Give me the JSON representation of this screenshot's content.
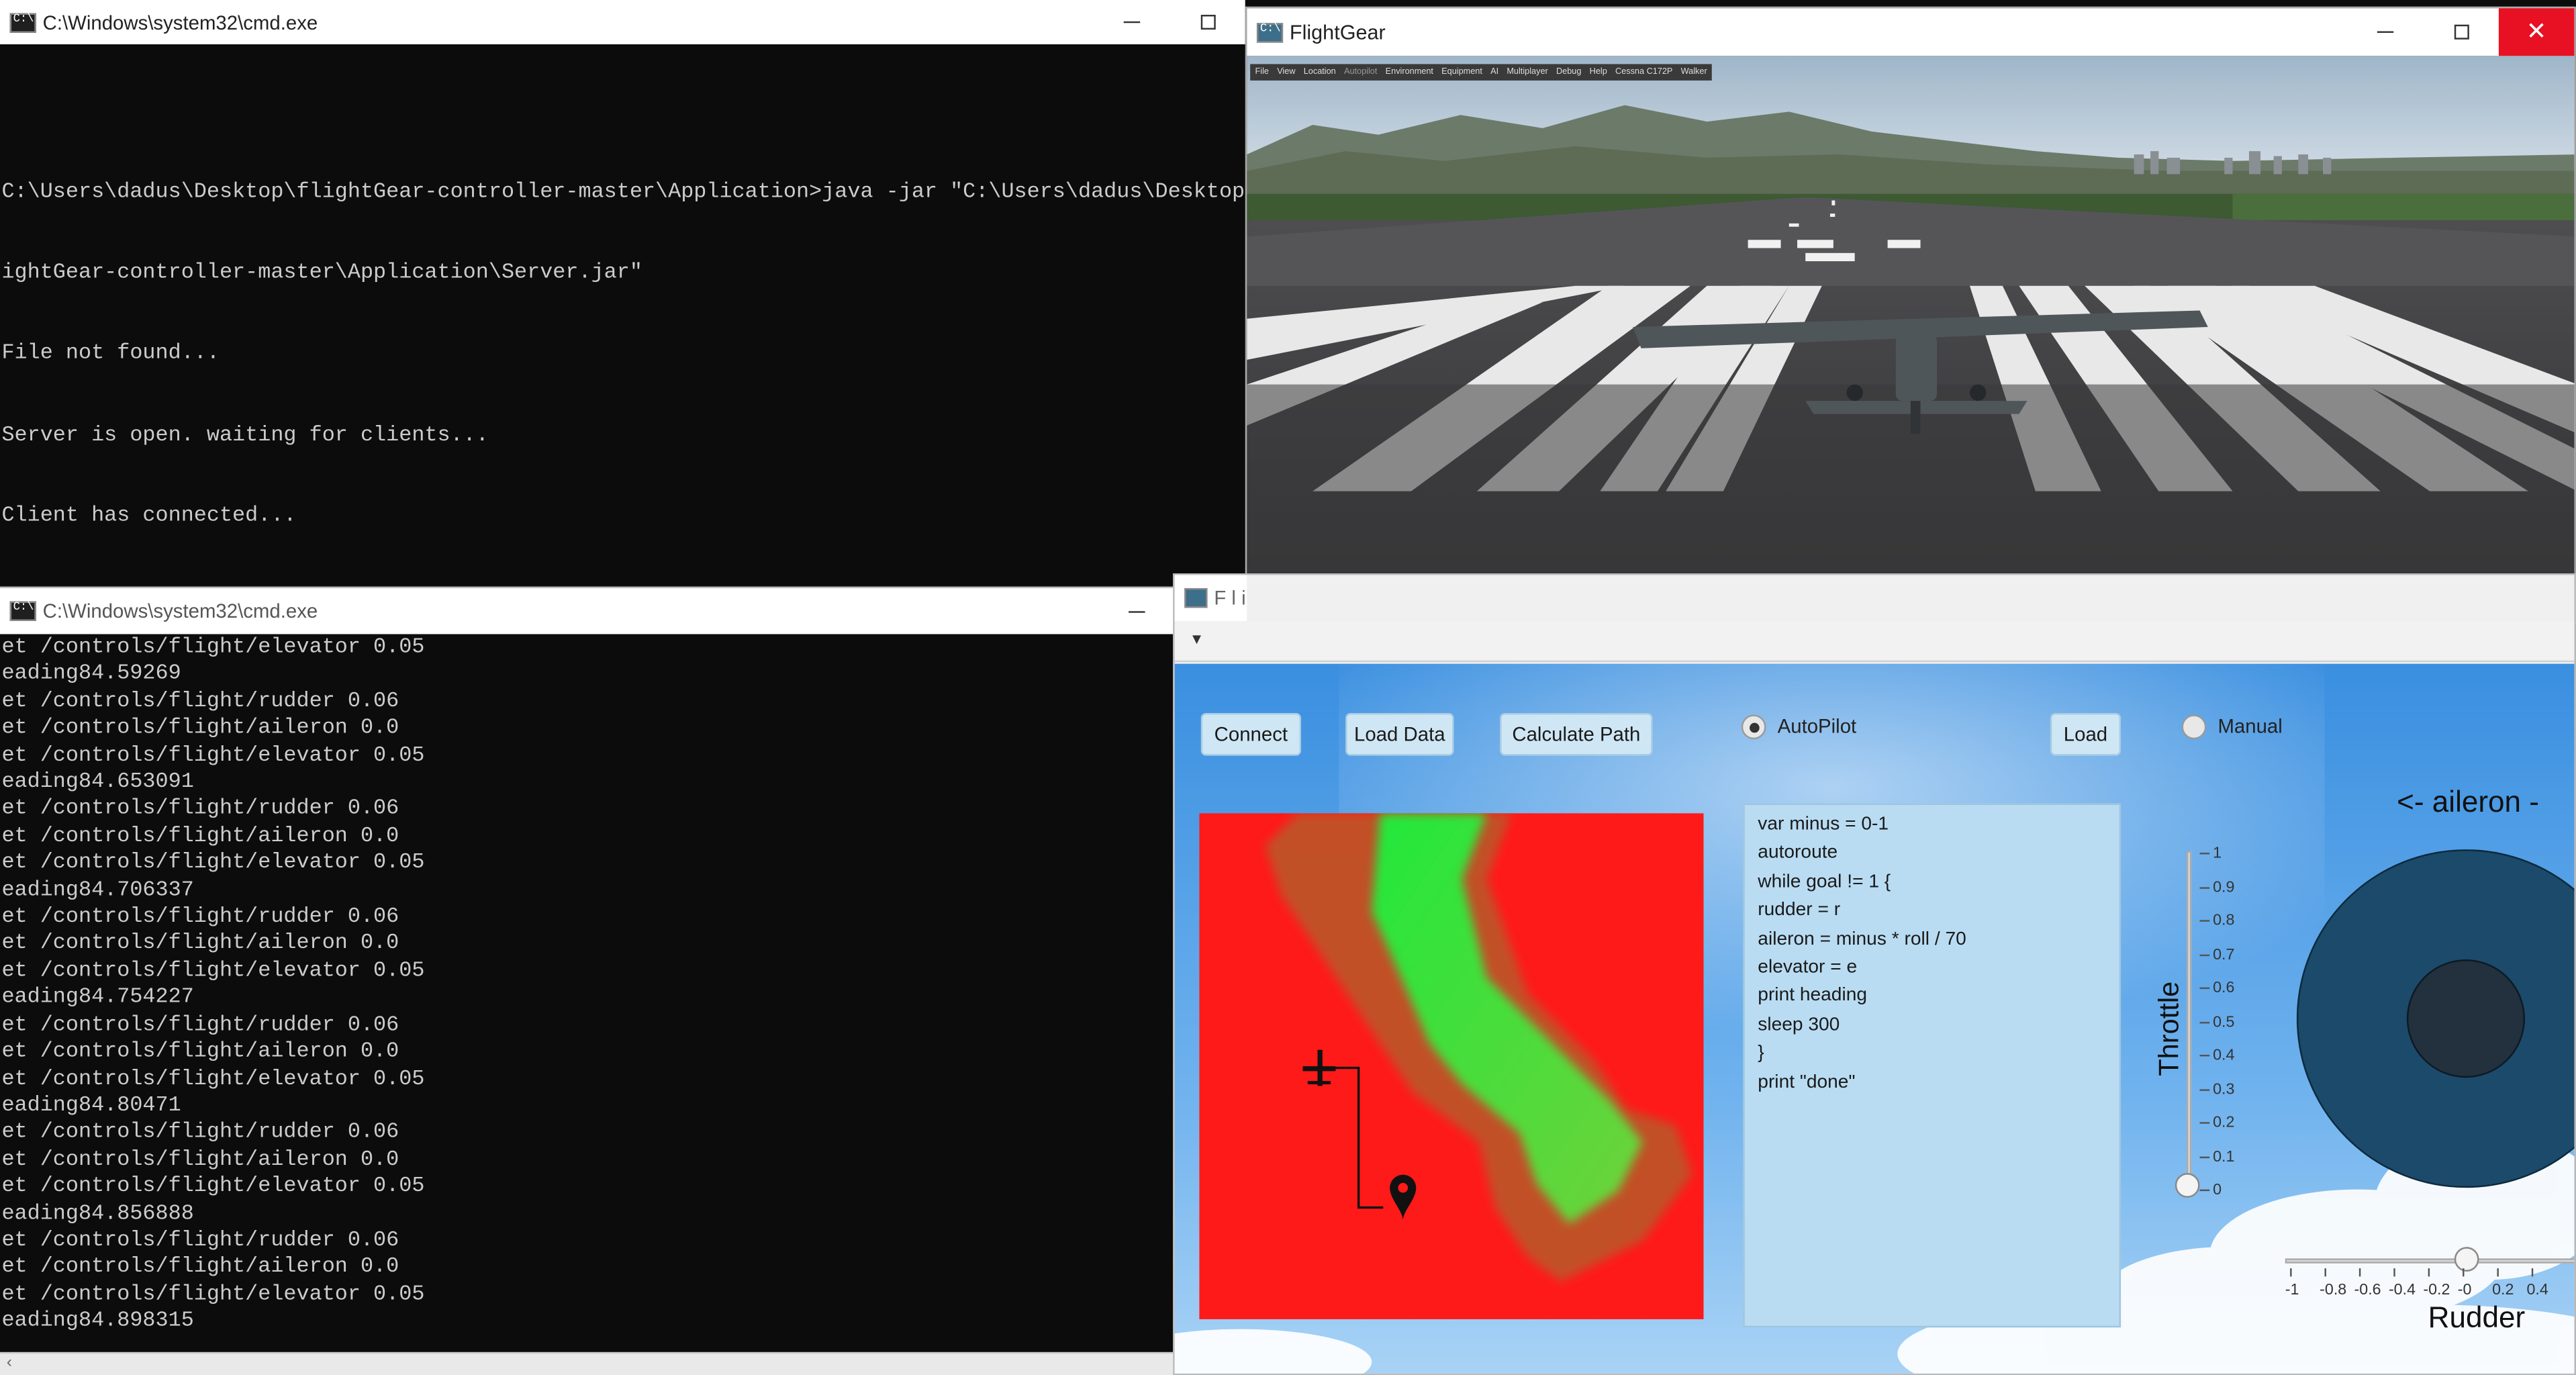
{
  "cmd_top": {
    "title": "C:\\Windows\\system32\\cmd.exe",
    "lines": [
      "",
      "C:\\Users\\dadus\\Desktop\\flightGear-controller-master\\Application>java -jar \"C:\\Users\\dadus\\Desktop\\flightGear-controller-master\\Application\\Server.jar\"",
      "ightGear-controller-master\\Application\\Server.jar\"",
      "File not found...",
      "Server is open. waiting for clients...",
      "Client has connected..."
    ]
  },
  "cmd_bottom": {
    "title": "C:\\Windows\\system32\\cmd.exe",
    "lines": [
      "et /controls/flight/elevator 0.05",
      "eading84.59269",
      "et /controls/flight/rudder 0.06",
      "et /controls/flight/aileron 0.0",
      "et /controls/flight/elevator 0.05",
      "eading84.653091",
      "et /controls/flight/rudder 0.06",
      "et /controls/flight/aileron 0.0",
      "et /controls/flight/elevator 0.05",
      "eading84.706337",
      "et /controls/flight/rudder 0.06",
      "et /controls/flight/aileron 0.0",
      "et /controls/flight/elevator 0.05",
      "eading84.754227",
      "et /controls/flight/rudder 0.06",
      "et /controls/flight/aileron 0.0",
      "et /controls/flight/elevator 0.05",
      "eading84.80471",
      "et /controls/flight/rudder 0.06",
      "et /controls/flight/aileron 0.0",
      "et /controls/flight/elevator 0.05",
      "eading84.856888",
      "et /controls/flight/rudder 0.06",
      "et /controls/flight/aileron 0.0",
      "et /controls/flight/elevator 0.05",
      "eading84.898315"
    ]
  },
  "flightgear": {
    "title": "FlightGear",
    "menu": [
      "File",
      "View",
      "Location",
      "Autopilot",
      "Environment",
      "Equipment",
      "AI",
      "Multiplayer",
      "Debug",
      "Help",
      "Cessna C172P",
      "Walker"
    ]
  },
  "app": {
    "title_fragment": "F l i",
    "buttons": {
      "connect": "Connect",
      "load_data": "Load Data",
      "calculate_path": "Calculate Path",
      "load": "Load"
    },
    "radio": {
      "autopilot": "AutoPilot",
      "manual": "Manual",
      "autopilot_selected": true,
      "manual_selected": false
    },
    "script_lines": [
      "var minus = 0-1",
      "autoroute",
      "while goal != 1 {",
      "rudder = r",
      "aileron = minus * roll / 70",
      "elevator = e",
      "print heading",
      "sleep 300",
      "}",
      "print \"done\""
    ],
    "throttle": {
      "label": "Throttle",
      "ticks": [
        "1",
        "0.9",
        "0.8",
        "0.7",
        "0.6",
        "0.5",
        "0.4",
        "0.3",
        "0.2",
        "0.1",
        "0"
      ],
      "value": 0
    },
    "aileron_label": "<- aileron -",
    "rudder": {
      "label": "Rudder",
      "ticks": [
        "-1",
        "-0.8",
        "-0.6",
        "-0.4",
        "-0.2",
        "-0",
        "0.2",
        "0.4"
      ],
      "value": 0
    },
    "colors": {
      "map_low": "#ff1a1a",
      "map_high": "#22e83a",
      "joystick_outer": "#1c4a6b",
      "joystick_inner": "#22313d"
    }
  }
}
